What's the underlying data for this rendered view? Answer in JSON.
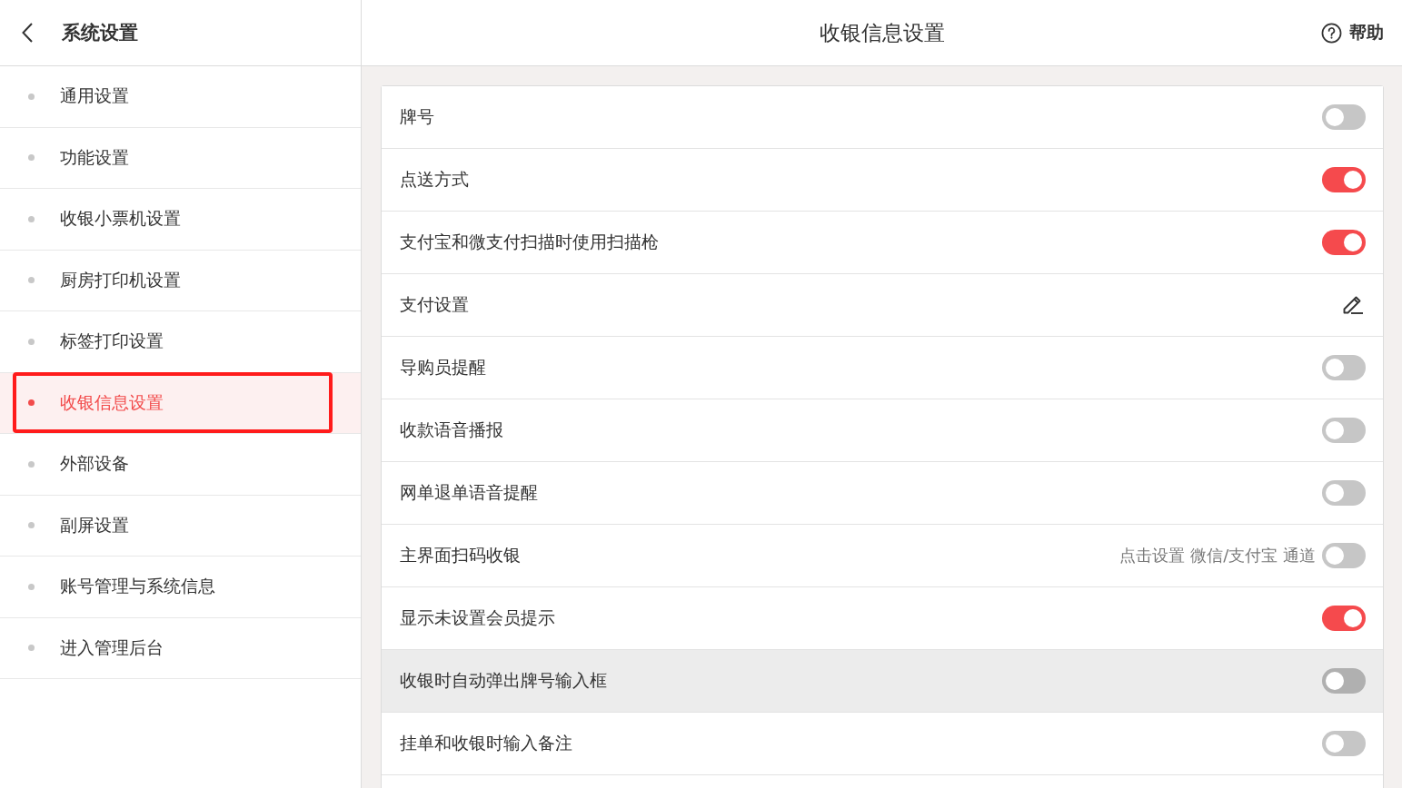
{
  "sidebar": {
    "title": "系统设置",
    "items": [
      {
        "label": "通用设置",
        "selected": false,
        "annotated": false
      },
      {
        "label": "功能设置",
        "selected": false,
        "annotated": false
      },
      {
        "label": "收银小票机设置",
        "selected": false,
        "annotated": false
      },
      {
        "label": "厨房打印机设置",
        "selected": false,
        "annotated": false
      },
      {
        "label": "标签打印设置",
        "selected": false,
        "annotated": false
      },
      {
        "label": "收银信息设置",
        "selected": true,
        "annotated": true
      },
      {
        "label": "外部设备",
        "selected": false,
        "annotated": false
      },
      {
        "label": "副屏设置",
        "selected": false,
        "annotated": false
      },
      {
        "label": "账号管理与系统信息",
        "selected": false,
        "annotated": false
      },
      {
        "label": "进入管理后台",
        "selected": false,
        "annotated": false
      }
    ]
  },
  "header": {
    "title": "收银信息设置",
    "help": "帮助"
  },
  "settings": [
    {
      "kind": "toggle",
      "label": "牌号",
      "on": false,
      "highlighted": false
    },
    {
      "kind": "toggle",
      "label": "点送方式",
      "on": true,
      "highlighted": false
    },
    {
      "kind": "toggle",
      "label": "支付宝和微支付扫描时使用扫描枪",
      "on": true,
      "highlighted": false
    },
    {
      "kind": "edit",
      "label": "支付设置",
      "highlighted": false
    },
    {
      "kind": "toggle",
      "label": "导购员提醒",
      "on": false,
      "highlighted": false
    },
    {
      "kind": "toggle",
      "label": "收款语音播报",
      "on": false,
      "highlighted": false
    },
    {
      "kind": "toggle",
      "label": "网单退单语音提醒",
      "on": false,
      "highlighted": false
    },
    {
      "kind": "toggle",
      "label": "主界面扫码收银",
      "hint": "点击设置 微信/支付宝 通道",
      "on": false,
      "highlighted": false
    },
    {
      "kind": "toggle",
      "label": "显示未设置会员提示",
      "on": true,
      "highlighted": false
    },
    {
      "kind": "toggle",
      "label": "收银时自动弹出牌号输入框",
      "on": false,
      "highlighted": true
    },
    {
      "kind": "toggle",
      "label": "挂单和收银时输入备注",
      "on": false,
      "highlighted": false
    }
  ]
}
